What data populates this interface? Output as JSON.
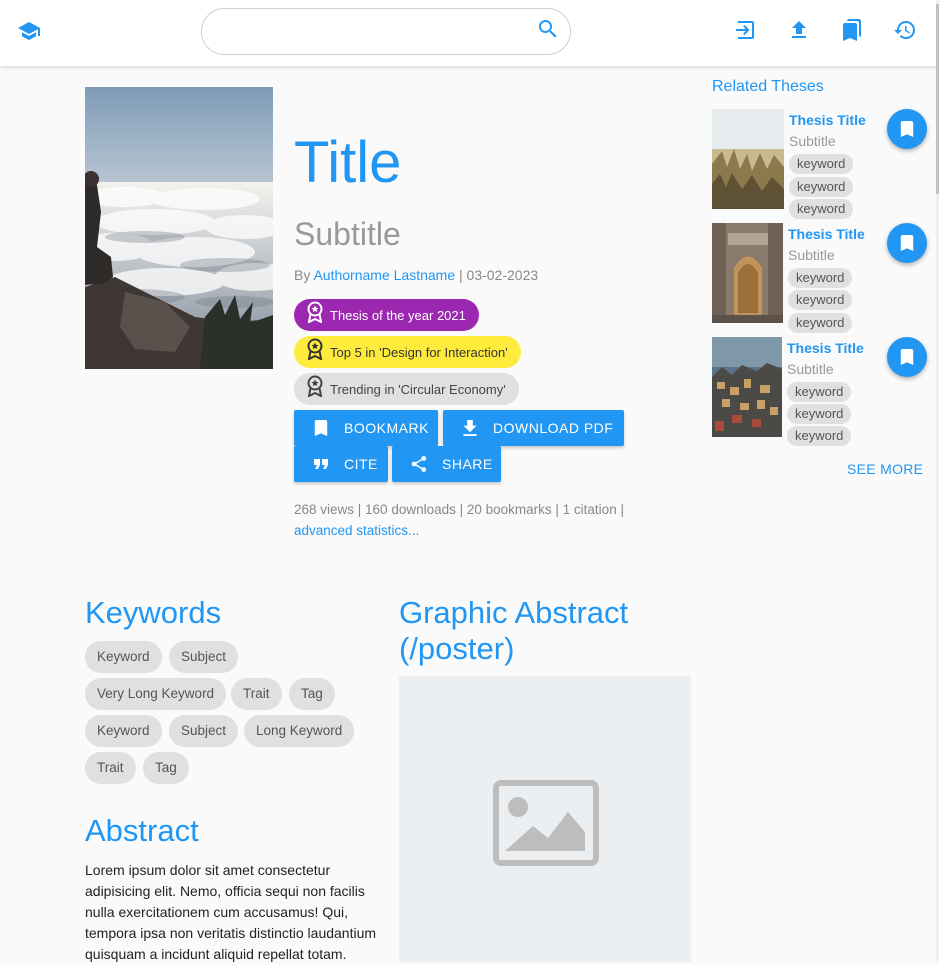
{
  "header": {
    "search": {
      "value": "",
      "placeholder": ""
    },
    "icons": [
      "graduation-cap-icon",
      "login-icon",
      "upload-icon",
      "bookmarks-icon",
      "history-icon"
    ]
  },
  "thesis": {
    "title": "Title",
    "subtitle": "Subtitle",
    "by": "By",
    "author": "Authorname Lastname",
    "separator": "|",
    "date": "03-02-2023",
    "awards": [
      {
        "label": "Thesis of the year 2021",
        "bg": "#9c27b0",
        "color": "#ffffff"
      },
      {
        "label": "Top 5 in 'Design for Interaction'",
        "bg": "#ffeb3b",
        "color": "#333333"
      },
      {
        "label": "Trending in 'Circular Economy'",
        "bg": "#e0e0e0",
        "color": "#444444"
      }
    ],
    "actions": {
      "bookmark": "BOOKMARK",
      "download": "DOWNLOAD PDF",
      "cite": "CITE",
      "share": "SHARE"
    },
    "stats": "268 views | 160 downloads | 20 bookmarks | 1 citation |",
    "advanced_stats": "advanced statistics..."
  },
  "related": {
    "heading": "Related Theses",
    "items": [
      {
        "title": "Thesis Title",
        "subtitle": "Subtitle",
        "keywords": [
          "keyword",
          "keyword",
          "keyword"
        ]
      },
      {
        "title": "Thesis Title",
        "subtitle": "Subtitle",
        "keywords": [
          "keyword",
          "keyword",
          "keyword"
        ]
      },
      {
        "title": "Thesis Title",
        "subtitle": "Subtitle",
        "keywords": [
          "keyword",
          "keyword",
          "keyword"
        ]
      }
    ],
    "see_more": "SEE MORE"
  },
  "keywords": {
    "heading": "Keywords",
    "items": [
      "Keyword",
      "Subject",
      "Very Long Keyword",
      "Trait",
      "Tag",
      "Keyword",
      "Subject",
      "Long Keyword",
      "Trait",
      "Tag"
    ]
  },
  "abstract": {
    "heading": "Abstract",
    "text": "Lorem ipsum dolor sit amet consectetur adipisicing elit. Nemo, officia sequi non facilis nulla exercitationem cum accusamus! Qui, tempora ipsa non veritatis distinctio laudantium quisquam a incidunt aliquid repellat totam."
  },
  "graphic_abstract": {
    "heading_line1": "Graphic Abstract",
    "heading_line2": "(/poster)"
  },
  "colors": {
    "accent": "#2196f3",
    "chip": "#e0e0e0",
    "placeholder": "#eceff1"
  }
}
